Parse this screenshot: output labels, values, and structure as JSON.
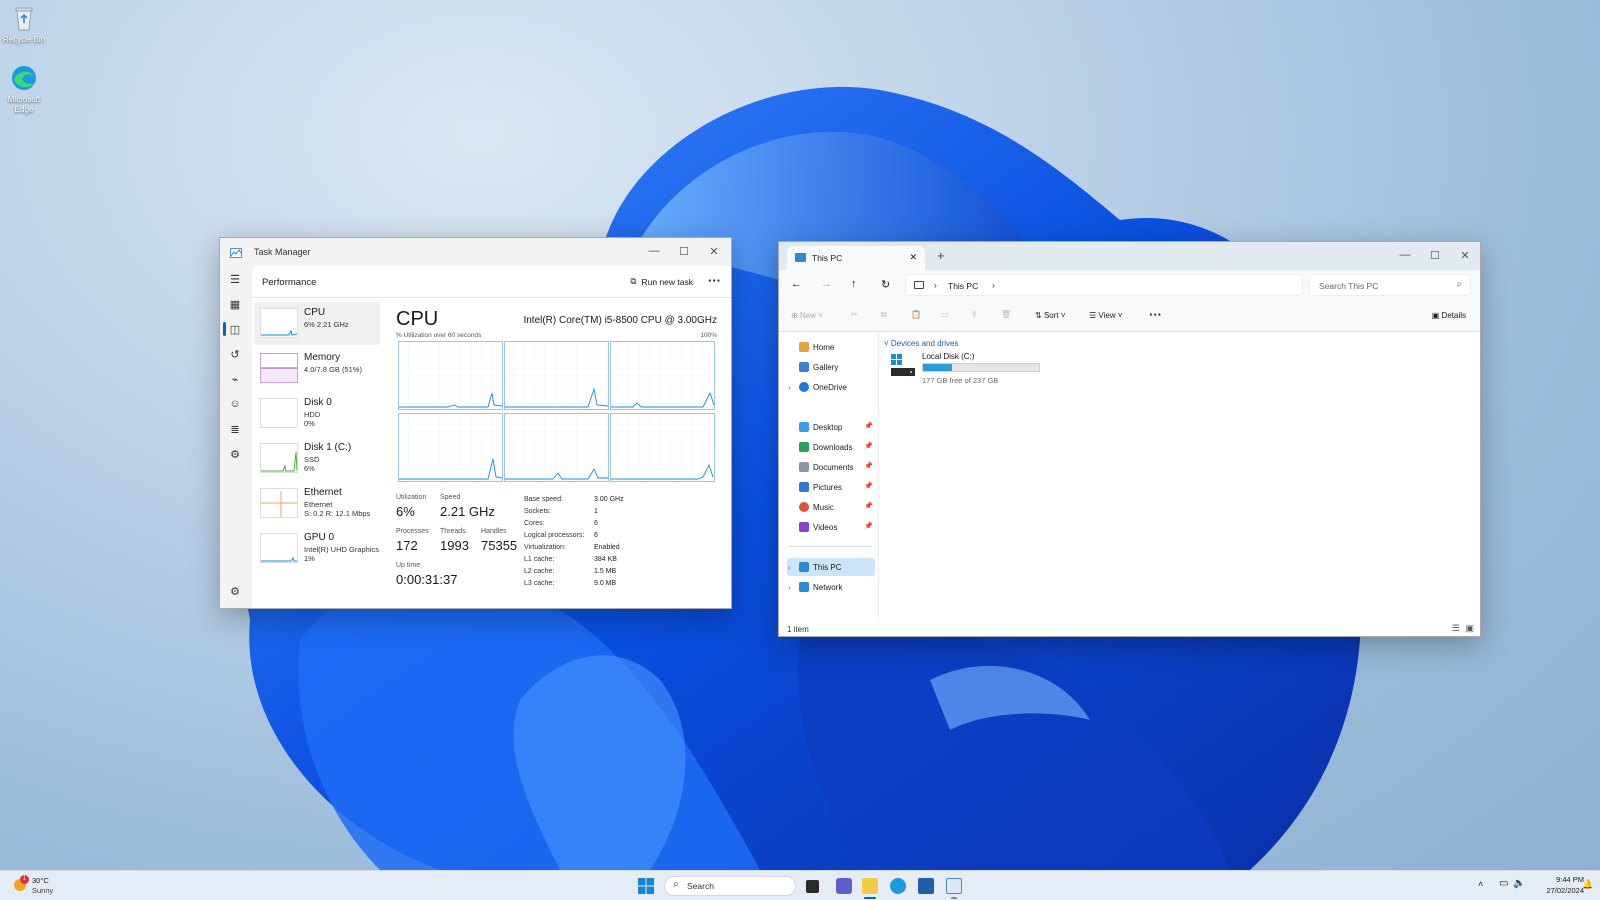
{
  "desktop": {
    "icons": [
      {
        "label": "Recycle Bin"
      },
      {
        "label": "Microsoft Edge"
      }
    ]
  },
  "task_manager": {
    "title": "Task Manager",
    "page": "Performance",
    "run_new_task": "Run new task",
    "resources": [
      {
        "name": "CPU",
        "l1": "6% 2.21 GHz",
        "l2": ""
      },
      {
        "name": "Memory",
        "l1": "4.0/7.8 GB (51%)",
        "l2": ""
      },
      {
        "name": "Disk 0",
        "l1": "HDD",
        "l2": "0%"
      },
      {
        "name": "Disk 1 (C:)",
        "l1": "SSD",
        "l2": "6%"
      },
      {
        "name": "Ethernet",
        "l1": "Ethernet",
        "l2": "S: 0.2 R: 12.1 Mbps"
      },
      {
        "name": "GPU 0",
        "l1": "Intel(R) UHD Graphics ...",
        "l2": "1%"
      }
    ],
    "detail": {
      "heading": "CPU",
      "model": "Intel(R) Core(TM) i5-8500 CPU @ 3.00GHz",
      "graph_label": "% Utilization over 60 seconds",
      "graph_max": "100%",
      "utilization_label": "Utilization",
      "utilization": "6%",
      "speed_label": "Speed",
      "speed": "2.21 GHz",
      "processes_label": "Processes",
      "processes": "172",
      "threads_label": "Threads",
      "threads": "1993",
      "handles_label": "Handles",
      "handles": "75355",
      "uptime_label": "Up time",
      "uptime": "0:00:31:37",
      "specs": [
        {
          "k": "Base speed:",
          "v": "3.00 GHz"
        },
        {
          "k": "Sockets:",
          "v": "1"
        },
        {
          "k": "Cores:",
          "v": "6"
        },
        {
          "k": "Logical processors:",
          "v": "6"
        },
        {
          "k": "Virtualization:",
          "v": "Enabled"
        },
        {
          "k": "L1 cache:",
          "v": "384 KB"
        },
        {
          "k": "L2 cache:",
          "v": "1.5 MB"
        },
        {
          "k": "L3 cache:",
          "v": "9.0 MB"
        }
      ]
    }
  },
  "explorer": {
    "tab_title": "This PC",
    "address": "This PC",
    "search_placeholder": "Search This PC",
    "commands": {
      "new": "New",
      "sort": "Sort",
      "view": "View",
      "details": "Details"
    },
    "sidebar": [
      {
        "label": "Home"
      },
      {
        "label": "Gallery"
      },
      {
        "label": "OneDrive"
      },
      {
        "label": "Desktop"
      },
      {
        "label": "Downloads"
      },
      {
        "label": "Documents"
      },
      {
        "label": "Pictures"
      },
      {
        "label": "Music"
      },
      {
        "label": "Videos"
      },
      {
        "label": "This PC"
      },
      {
        "label": "Network"
      }
    ],
    "group": "Devices and drives",
    "drive": {
      "name": "Local Disk (C:)",
      "free": "177 GB free of 237 GB",
      "used_fraction": 0.253
    },
    "status": "1 item"
  },
  "taskbar": {
    "weather_temp": "30°C",
    "weather_desc": "Sunny",
    "weather_badge": "1",
    "search": "Search",
    "time": "9:44 PM",
    "date": "27/02/2024"
  },
  "colors": {
    "accent": "#0067c0",
    "cpu_line": "#1a8fd6",
    "drive_bar": "#26a0da"
  }
}
